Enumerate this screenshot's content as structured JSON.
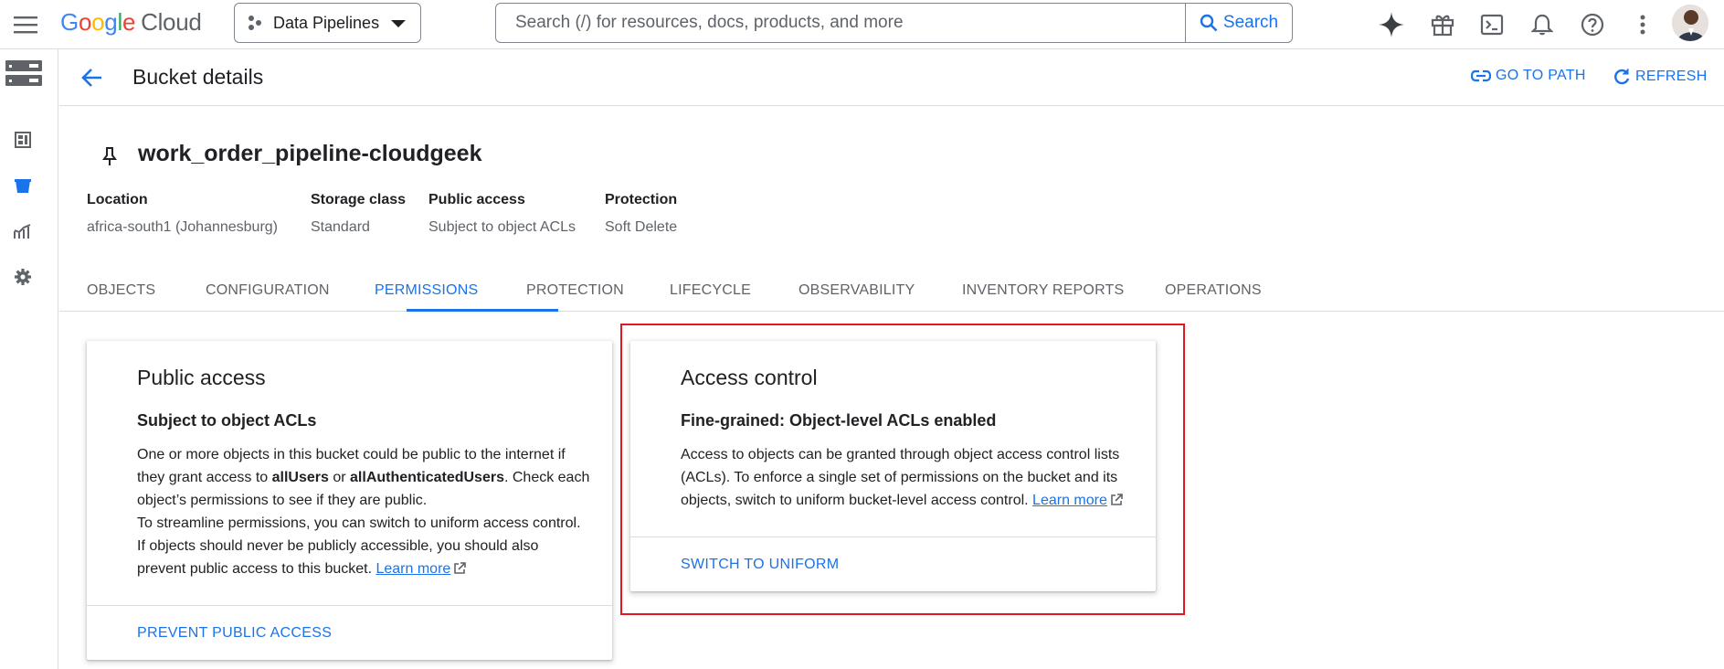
{
  "topbar": {
    "logo_google": "Google",
    "logo_cloud": "Cloud",
    "project_name": "Data Pipelines",
    "search_placeholder": "Search (/) for resources, docs, products, and more",
    "search_button": "Search"
  },
  "page_header": {
    "title": "Bucket details",
    "go_to_path": "GO TO PATH",
    "refresh": "REFRESH"
  },
  "bucket": {
    "name": "work_order_pipeline-cloudgeek",
    "info": [
      {
        "label": "Location",
        "value": "africa-south1 (Johannesburg)"
      },
      {
        "label": "Storage class",
        "value": "Standard"
      },
      {
        "label": "Public access",
        "value": "Subject to object ACLs"
      },
      {
        "label": "Protection",
        "value": "Soft Delete"
      }
    ]
  },
  "tabs": [
    {
      "label": "OBJECTS"
    },
    {
      "label": "CONFIGURATION"
    },
    {
      "label": "PERMISSIONS",
      "active": true
    },
    {
      "label": "PROTECTION"
    },
    {
      "label": "LIFECYCLE"
    },
    {
      "label": "OBSERVABILITY"
    },
    {
      "label": "INVENTORY REPORTS"
    },
    {
      "label": "OPERATIONS"
    }
  ],
  "public_access_card": {
    "title": "Public access",
    "subtitle": "Subject to object ACLs",
    "body_1": "One or more objects in this bucket could be public to the internet if",
    "body_2a": "they grant access to ",
    "body_2b": "allUsers",
    "body_2c": " or ",
    "body_2d": "allAuthenticatedUsers",
    "body_2e": ". Check each",
    "body_3": "object’s permissions to see if they are public.",
    "body_4": "To streamline permissions, you can switch to uniform access control.",
    "body_5": "If objects should never be publicly accessible, you should also",
    "body_6": "prevent public access to this bucket. ",
    "learn_more": "Learn more",
    "action": "PREVENT PUBLIC ACCESS"
  },
  "access_control_card": {
    "title": "Access control",
    "subtitle": "Fine-grained: Object-level ACLs enabled",
    "body_1": "Access to objects can be granted through object access control lists",
    "body_2": "(ACLs). To enforce a single set of permissions on the bucket and its",
    "body_3": "objects, switch to uniform bucket-level access control. ",
    "learn_more": "Learn more",
    "action": "SWITCH TO UNIFORM"
  },
  "colors": {
    "accent": "#1a73e8",
    "highlight_box": "#e0181f",
    "border": "#dadce0"
  }
}
